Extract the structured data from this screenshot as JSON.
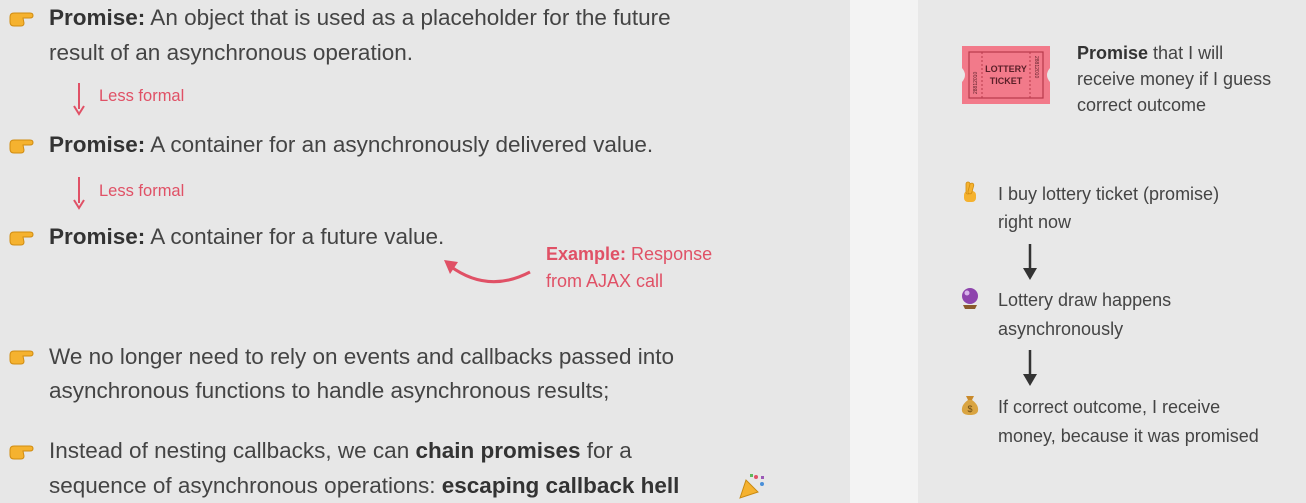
{
  "left": {
    "items": [
      {
        "bold": "Promise:",
        "line1": " An object that is used as a placeholder for the future",
        "line2": "result of an asynchronous operation."
      },
      {
        "bold": "Promise:",
        "line1": " A container for an asynchronously delivered value."
      },
      {
        "bold": "Promise:",
        "line1": " A container for a future value."
      }
    ],
    "less_formal_1": "Less formal",
    "less_formal_2": "Less formal",
    "example_bold": "Example:",
    "example_rest1": " Response",
    "example_rest2": "from AJAX call",
    "bullet4_line1": "We no longer need to rely on events and callbacks passed into",
    "bullet4_line2": "asynchronous functions to handle asynchronous results;",
    "bullet5_pre": "Instead of nesting callbacks, we can ",
    "bullet5_bold1": "chain promises",
    "bullet5_post": " for a",
    "bullet5_line2_pre": "sequence of asynchronous operations: ",
    "bullet5_bold2": "escaping callback hell",
    "icons": {
      "bullet": "pointing-hand-icon",
      "party": "party-popper-icon"
    }
  },
  "right": {
    "ticket_label_1": "LOTTERY",
    "ticket_label_2": "TICKET",
    "ticket_serial": "28812010",
    "promise_bold": "Promise",
    "promise_line1_rest": " that I will",
    "promise_line2": "receive money if I guess",
    "promise_line3": "correct outcome",
    "steps": [
      {
        "icon": "crossed-fingers-icon",
        "line1": "I buy lottery ticket (promise)",
        "line2": "right now"
      },
      {
        "icon": "crystal-ball-icon",
        "line1": "Lottery draw happens",
        "line2": "asynchronously"
      },
      {
        "icon": "money-bag-icon",
        "line1": "If correct outcome, I receive",
        "line2": "money, because it was promised"
      }
    ]
  },
  "colors": {
    "accent": "#e05166",
    "text": "#444444",
    "ticket": "#f27a8a"
  }
}
